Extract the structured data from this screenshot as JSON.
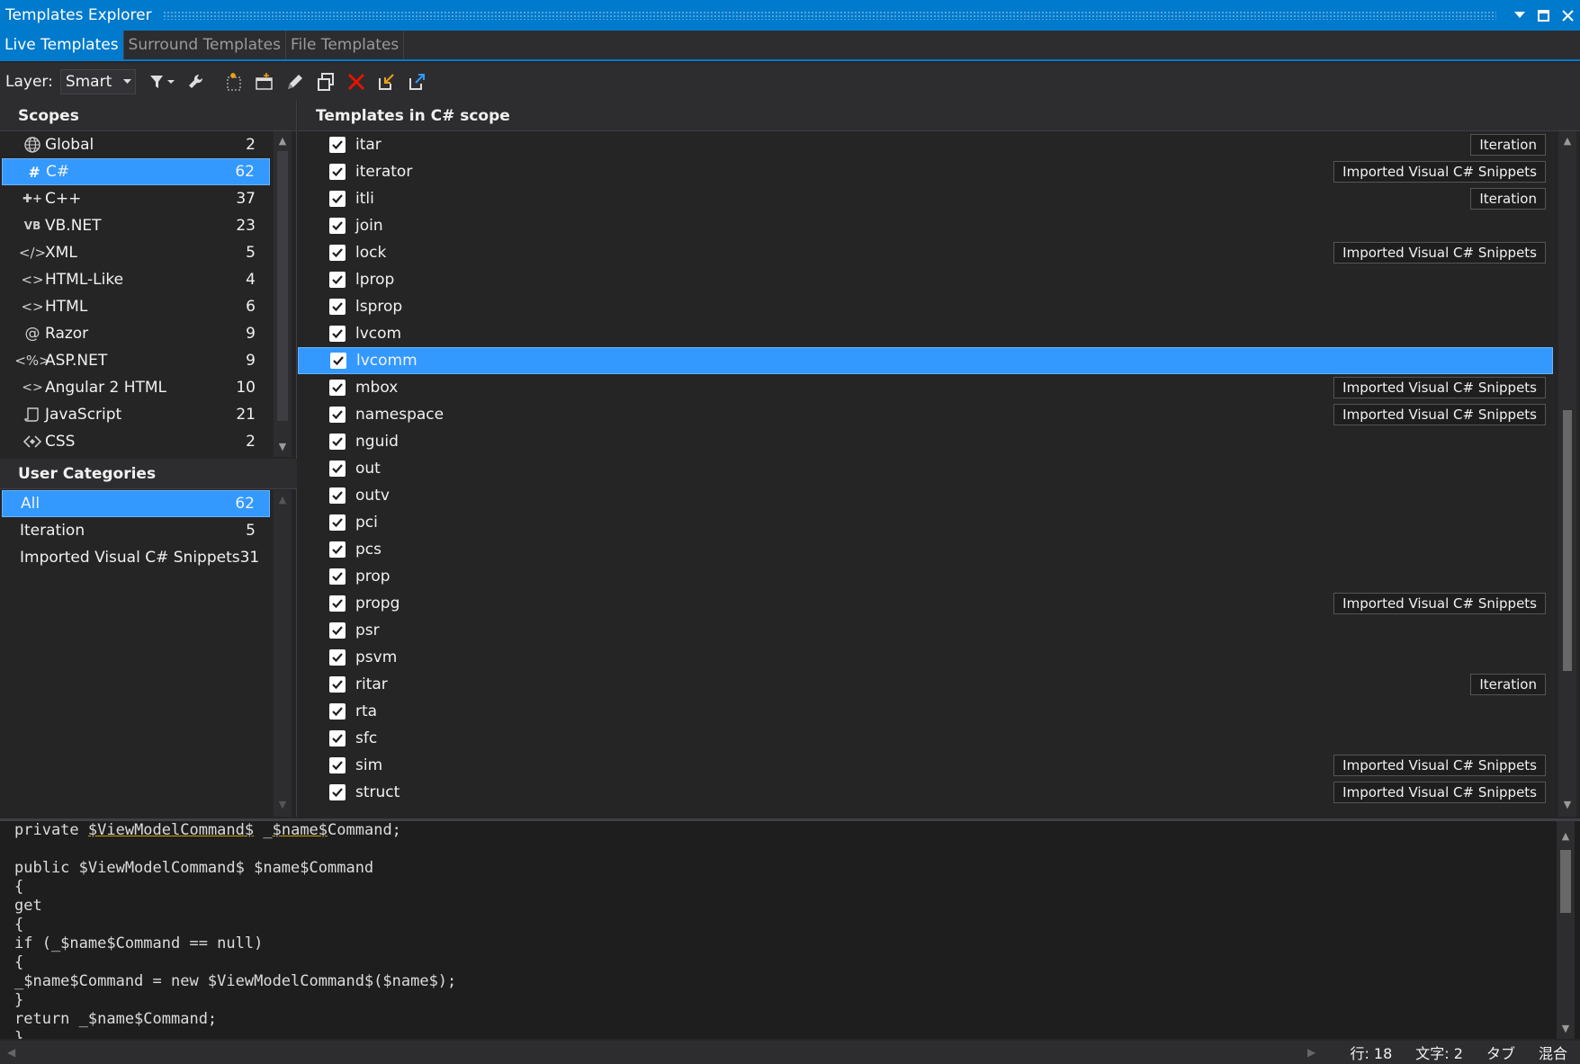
{
  "window": {
    "title": "Templates Explorer"
  },
  "tabs": [
    {
      "label": "Live Templates",
      "active": true
    },
    {
      "label": "Surround Templates",
      "active": false
    },
    {
      "label": "File Templates",
      "active": false
    }
  ],
  "toolbar": {
    "layer_label": "Layer:",
    "layer_value": "Smart",
    "icons": [
      "filter-icon",
      "wrench-icon",
      "new-template-icon",
      "new-folder-icon",
      "edit-icon",
      "duplicate-icon",
      "delete-icon",
      "import-icon",
      "export-icon"
    ]
  },
  "scopes": {
    "header": "Scopes",
    "items": [
      {
        "icon": "globe-icon",
        "label": "Global",
        "count": "2"
      },
      {
        "icon": "csharp-icon",
        "label": "C#",
        "count": "62",
        "selected": true
      },
      {
        "icon": "cpp-icon",
        "label": "C++",
        "count": "37"
      },
      {
        "icon": "vb-icon",
        "label": "VB.NET",
        "count": "23"
      },
      {
        "icon": "xml-icon",
        "label": "XML",
        "count": "5"
      },
      {
        "icon": "html-like-icon",
        "label": "HTML-Like",
        "count": "4"
      },
      {
        "icon": "html-icon",
        "label": "HTML",
        "count": "6"
      },
      {
        "icon": "razor-icon",
        "label": "Razor",
        "count": "9"
      },
      {
        "icon": "aspnet-icon",
        "label": "ASP.NET",
        "count": "9"
      },
      {
        "icon": "angular-icon",
        "label": "Angular 2 HTML",
        "count": "10"
      },
      {
        "icon": "javascript-icon",
        "label": "JavaScript",
        "count": "21"
      },
      {
        "icon": "css-icon",
        "label": "CSS",
        "count": "2"
      }
    ]
  },
  "categories": {
    "header": "User Categories",
    "items": [
      {
        "label": "All",
        "count": "62",
        "selected": true
      },
      {
        "label": "Iteration",
        "count": "5"
      },
      {
        "label": "Imported Visual C# Snippets",
        "count": "31"
      }
    ]
  },
  "templates": {
    "header": "Templates in C# scope",
    "items": [
      {
        "name": "itar",
        "category": "Iteration"
      },
      {
        "name": "iterator",
        "category": "Imported Visual C# Snippets"
      },
      {
        "name": "itli",
        "category": "Iteration"
      },
      {
        "name": "join",
        "category": ""
      },
      {
        "name": "lock",
        "category": "Imported Visual C# Snippets"
      },
      {
        "name": "lprop",
        "category": ""
      },
      {
        "name": "lsprop",
        "category": ""
      },
      {
        "name": "lvcom",
        "category": ""
      },
      {
        "name": "lvcomm",
        "category": "",
        "selected": true
      },
      {
        "name": "mbox",
        "category": "Imported Visual C# Snippets"
      },
      {
        "name": "namespace",
        "category": "Imported Visual C# Snippets"
      },
      {
        "name": "nguid",
        "category": ""
      },
      {
        "name": "out",
        "category": ""
      },
      {
        "name": "outv",
        "category": ""
      },
      {
        "name": "pci",
        "category": ""
      },
      {
        "name": "pcs",
        "category": ""
      },
      {
        "name": "prop",
        "category": ""
      },
      {
        "name": "propg",
        "category": "Imported Visual C# Snippets"
      },
      {
        "name": "psr",
        "category": ""
      },
      {
        "name": "psvm",
        "category": ""
      },
      {
        "name": "ritar",
        "category": "Iteration"
      },
      {
        "name": "rta",
        "category": ""
      },
      {
        "name": "sfc",
        "category": ""
      },
      {
        "name": "sim",
        "category": "Imported Visual C# Snippets"
      },
      {
        "name": "struct",
        "category": "Imported Visual C# Snippets"
      }
    ]
  },
  "editor": {
    "lines": [
      "private $ViewModelCommand$ _$name$Command;",
      "",
      "public $ViewModelCommand$ $name$Command",
      "{",
      "get",
      "{",
      "if (_$name$Command == null)",
      "{",
      "_$name$Command = new $ViewModelCommand$($name$);",
      "}",
      "return _$name$Command;",
      "}"
    ]
  },
  "status": {
    "line": "行: 18",
    "char": "文字: 2",
    "tab": "タブ",
    "mode": "混合"
  },
  "colors": {
    "accent": "#007acc",
    "selection": "#3399ff",
    "background": "#252526",
    "editor_bg": "#1e1e1e",
    "delete_red": "#e51400"
  }
}
